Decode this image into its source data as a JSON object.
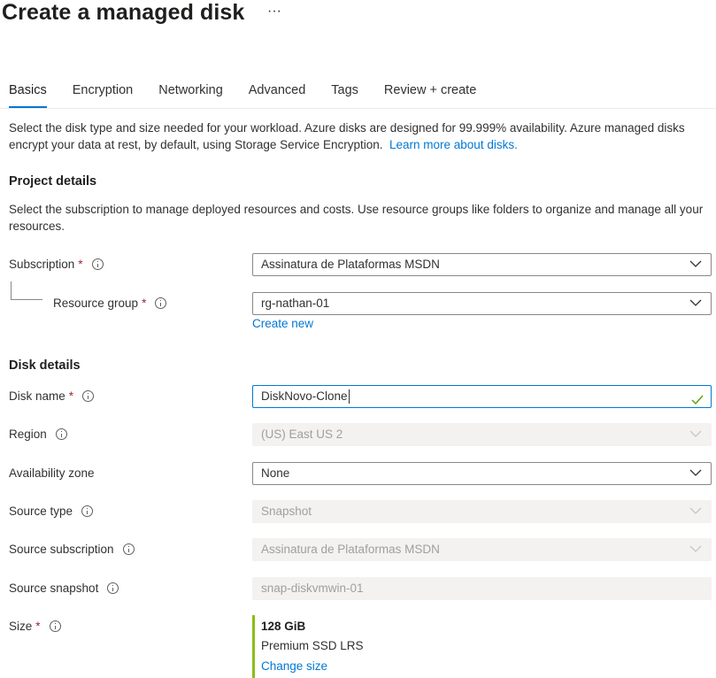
{
  "header": {
    "title": "Create a managed disk",
    "more_label": "···"
  },
  "tabs": [
    {
      "label": "Basics"
    },
    {
      "label": "Encryption"
    },
    {
      "label": "Networking"
    },
    {
      "label": "Advanced"
    },
    {
      "label": "Tags"
    },
    {
      "label": "Review + create"
    }
  ],
  "intro": {
    "text": "Select the disk type and size needed for your workload. Azure disks are designed for 99.999% availability. Azure managed disks encrypt your data at rest, by default, using Storage Service Encryption.",
    "link": "Learn more about disks."
  },
  "project": {
    "title": "Project details",
    "description": "Select the subscription to manage deployed resources and costs. Use resource groups like folders to organize and manage all your resources.",
    "subscription_label": "Subscription",
    "subscription_value": "Assinatura de Plataformas MSDN",
    "resource_group_label": "Resource group",
    "resource_group_value": "rg-nathan-01",
    "create_new": "Create new"
  },
  "disk": {
    "title": "Disk details",
    "name_label": "Disk name",
    "name_value": "DiskNovo-Clone",
    "region_label": "Region",
    "region_value": "(US) East US 2",
    "zone_label": "Availability zone",
    "zone_value": "None",
    "source_type_label": "Source type",
    "source_type_value": "Snapshot",
    "source_sub_label": "Source subscription",
    "source_sub_value": "Assinatura de Plataformas MSDN",
    "source_snap_label": "Source snapshot",
    "source_snap_value": "snap-diskvmwin-01",
    "size_label": "Size",
    "size_value": "128 GiB",
    "size_type": "Premium SSD LRS",
    "change_size": "Change size"
  },
  "required_mark": "*",
  "colors": {
    "accent": "#0078d4",
    "required": "#a4262c",
    "valid": "#57a300",
    "size_bar": "#8cbd18"
  }
}
